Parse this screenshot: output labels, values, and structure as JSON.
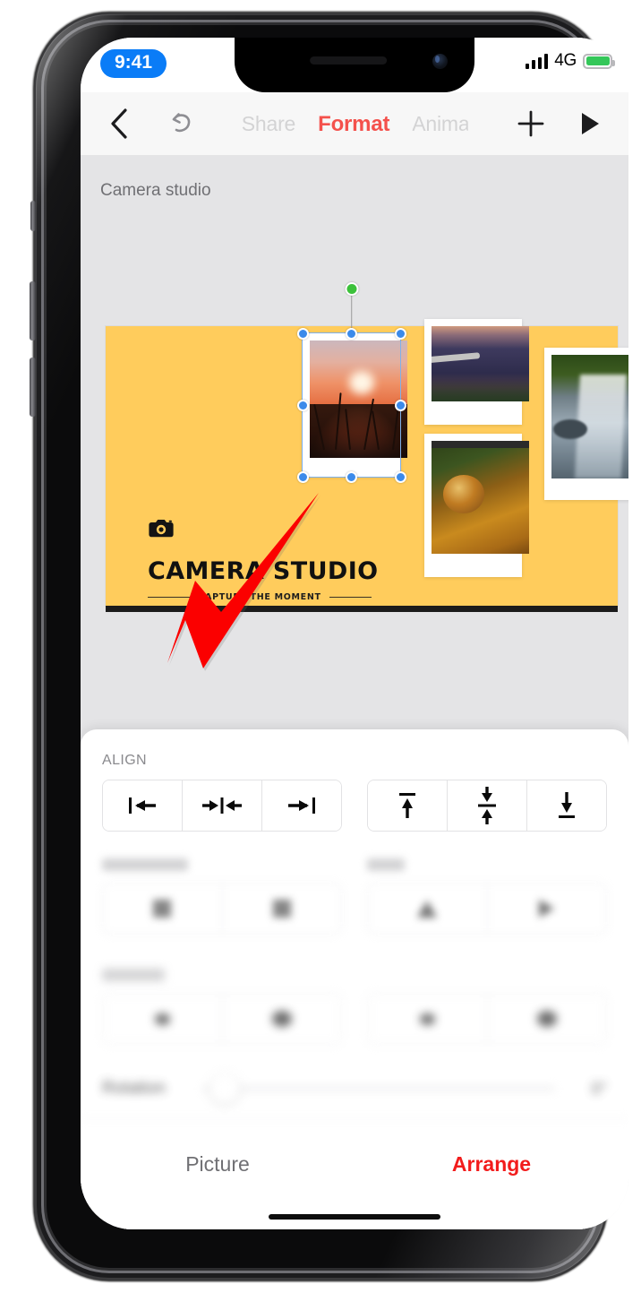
{
  "status_bar": {
    "time": "9:41",
    "network": "4G",
    "signal_icon": "cellular-signal-icon",
    "battery_icon": "battery-full-icon",
    "battery_color": "#34c759",
    "time_pill_color": "#0a7cf7"
  },
  "toolbar": {
    "back_icon": "chevron-left-icon",
    "undo_icon": "undo-arrow-icon",
    "add_icon": "plus-icon",
    "play_icon": "play-triangle-icon",
    "tabs": [
      {
        "label": "Share",
        "active": false
      },
      {
        "label": "Format",
        "active": true
      },
      {
        "label": "Animat",
        "active": false
      }
    ],
    "accent_color": "#f4514c"
  },
  "canvas": {
    "slide_name": "Camera studio",
    "background_color": "#e4e4e6",
    "slide": {
      "background_color": "#ffcc5c",
      "camera_icon": "camera-icon",
      "title": "CAMERA STUDIO",
      "subtitle": "CAPTURE THE MOMENT",
      "photos": [
        {
          "name": "photo-sunset",
          "alt": "sunset-branches-photo",
          "selected": true
        },
        {
          "name": "photo-mountain",
          "alt": "mountain-range-photo",
          "selected": false
        },
        {
          "name": "photo-spider",
          "alt": "spider-macro-photo",
          "selected": false
        },
        {
          "name": "photo-waterfall",
          "alt": "waterfall-photo",
          "selected": false
        }
      ]
    },
    "selection": {
      "handle_color": "#3b8aea",
      "rotate_handle_color": "#3cc13b",
      "handles": [
        "top-left",
        "top-center",
        "top-right",
        "middle-left",
        "middle-right",
        "bottom-left",
        "bottom-center",
        "bottom-right"
      ]
    },
    "annotation": {
      "arrow_icon": "red-pointer-arrow",
      "color": "#fb0000"
    }
  },
  "format_panel": {
    "align": {
      "label": "ALIGN",
      "horizontal_buttons": [
        {
          "name": "align-left-button",
          "icon": "align-left-icon"
        },
        {
          "name": "align-center-button",
          "icon": "align-center-horizontal-icon"
        },
        {
          "name": "align-right-button",
          "icon": "align-right-icon"
        }
      ],
      "vertical_buttons": [
        {
          "name": "align-top-button",
          "icon": "align-top-icon"
        },
        {
          "name": "align-middle-button",
          "icon": "align-middle-vertical-icon"
        },
        {
          "name": "align-bottom-button",
          "icon": "align-bottom-icon"
        }
      ]
    },
    "distribute": {
      "label": "DISTRIBUTE",
      "blurred": true
    },
    "flip": {
      "label": "FLIP",
      "blurred": true
    },
    "order": {
      "label": "ORDER",
      "blurred": true
    },
    "rotation": {
      "label": "Rotation",
      "value": "0°",
      "blurred": true,
      "slider_position_pct": 3
    },
    "tabs": [
      {
        "label": "Picture",
        "active": false
      },
      {
        "label": "Arrange",
        "active": true
      }
    ],
    "active_tab_color": "#f21c1c"
  }
}
